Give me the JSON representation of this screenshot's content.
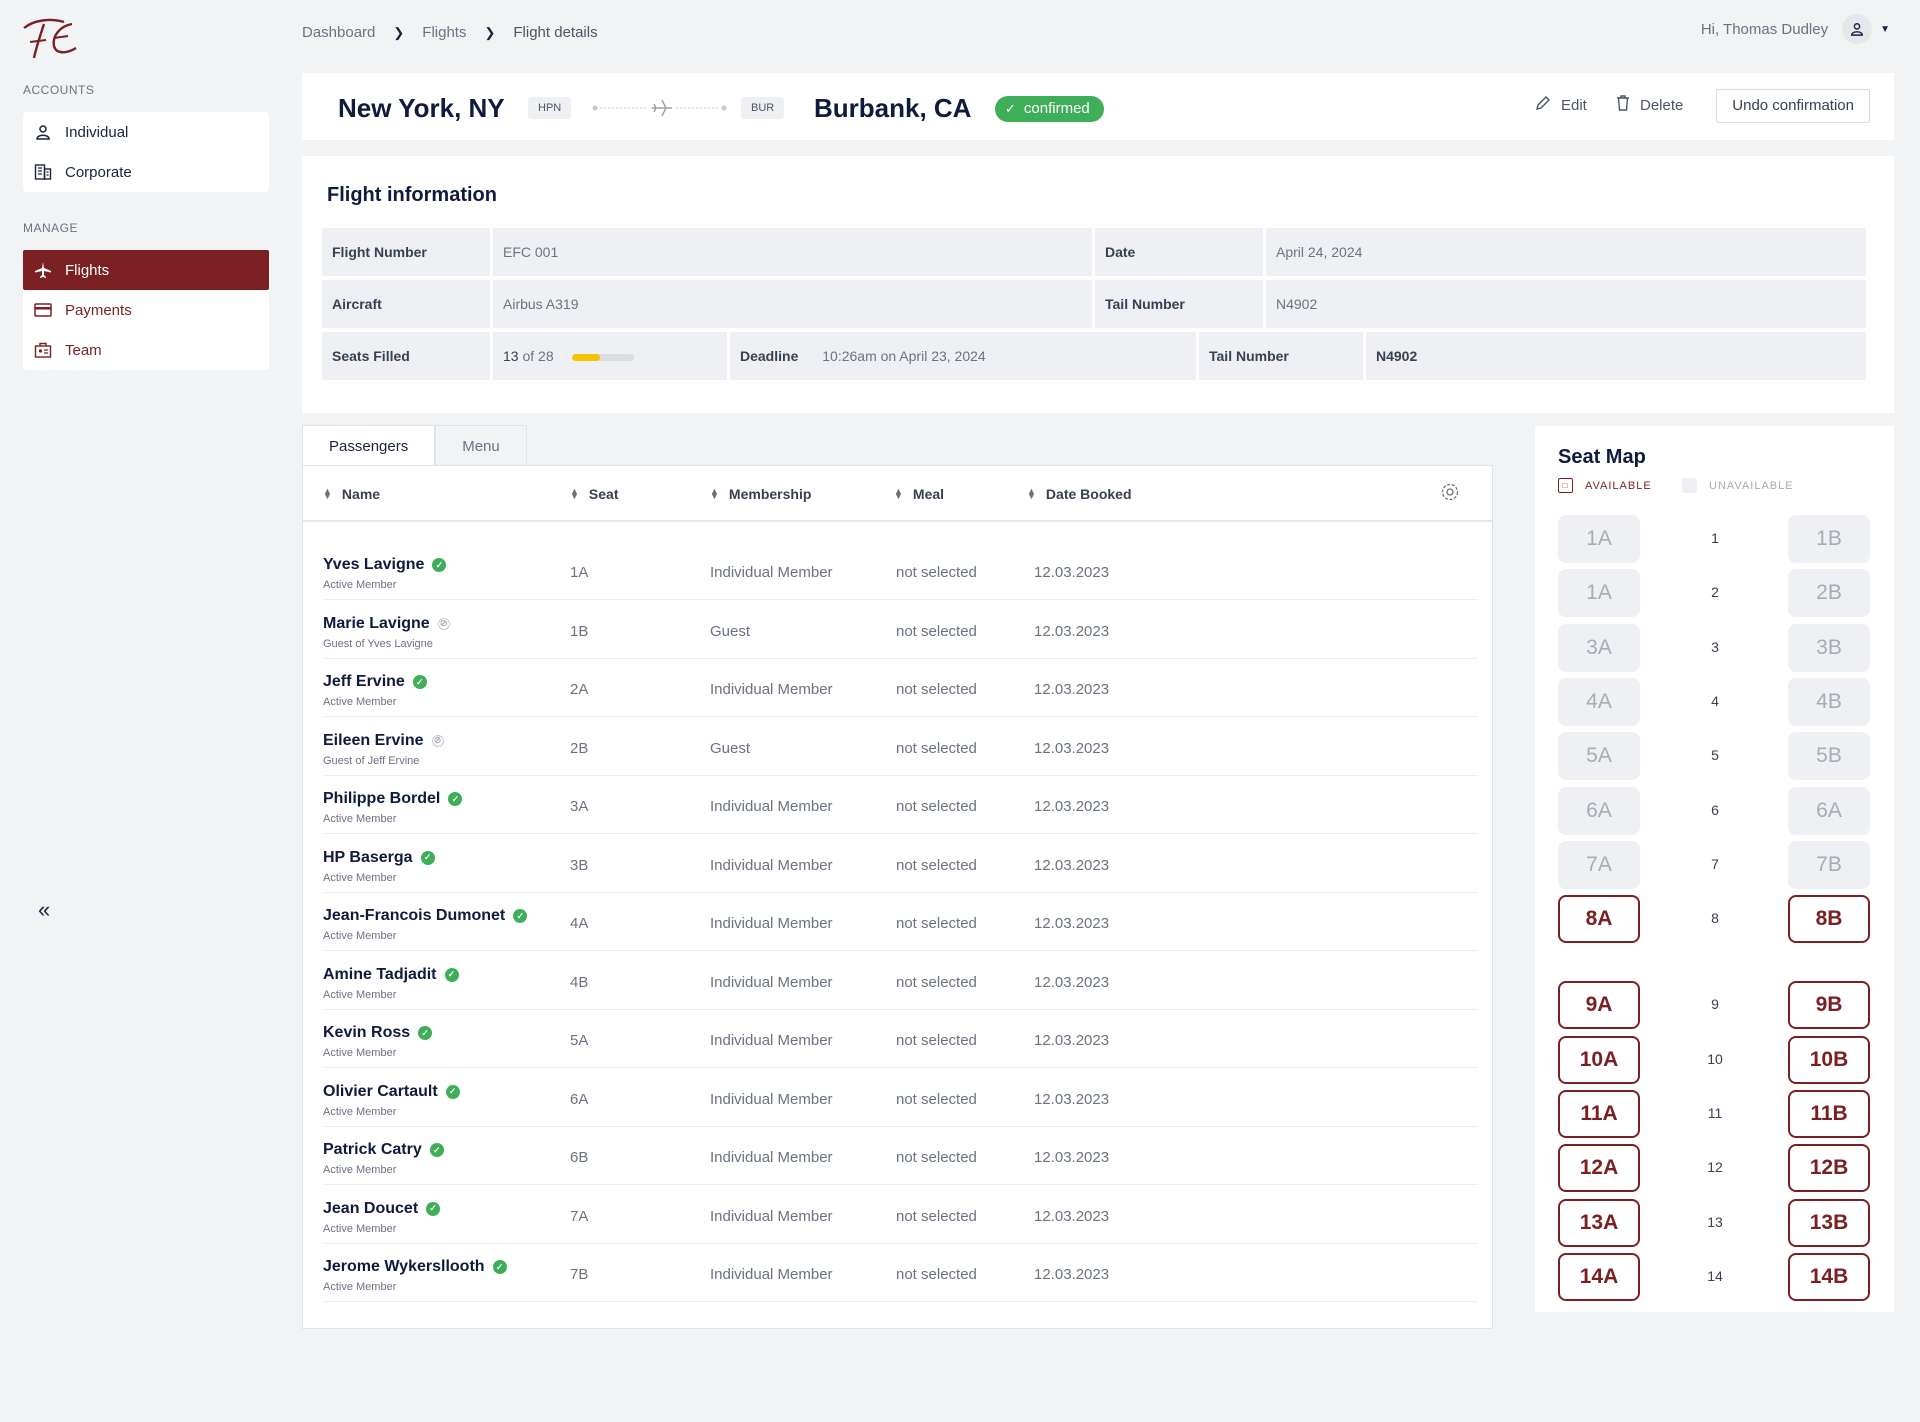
{
  "sidebar": {
    "accounts_label": "ACCOUNTS",
    "accounts": [
      {
        "label": "Individual",
        "icon": "user-icon"
      },
      {
        "label": "Corporate",
        "icon": "building-icon"
      }
    ],
    "manage_label": "MANAGE",
    "manage": [
      {
        "label": "Flights",
        "icon": "plane-icon",
        "active": true
      },
      {
        "label": "Payments",
        "icon": "credit-card-icon"
      },
      {
        "label": "Team",
        "icon": "team-icon"
      }
    ],
    "collapse_icon": "«"
  },
  "breadcrumb": [
    "Dashboard",
    "Flights",
    "Flight details"
  ],
  "user": {
    "greeting": "Hi, Thomas Dudley"
  },
  "route": {
    "origin": "New York, NY",
    "origin_code": "HPN",
    "destination": "Burbank, CA",
    "destination_code": "BUR",
    "status": "confirmed",
    "edit_label": "Edit",
    "delete_label": "Delete",
    "undo_label": "Undo confirmation"
  },
  "flight_info": {
    "title": "Flight information",
    "flight_number_label": "Flight Number",
    "flight_number": "EFC 001",
    "date_label": "Date",
    "date": "April 24, 2024",
    "aircraft_label": "Aircraft",
    "aircraft": "Airbus A319",
    "tail_label": "Tail Number",
    "tail": "N4902",
    "seats_label": "Seats Filled",
    "seats_filled": "13",
    "seats_of": "of 28",
    "seats_fraction": 0.46,
    "deadline_label": "Deadline",
    "deadline": "10:26am on April 23, 2024",
    "tail_label_2": "Tail Number",
    "tail_2": "N4902"
  },
  "tabs": [
    "Passengers",
    "Menu"
  ],
  "table": {
    "columns": [
      "Name",
      "Seat",
      "Membership",
      "Meal",
      "Date Booked"
    ],
    "rows": [
      {
        "name": "Yves Lavigne",
        "type": "member",
        "sub": "Active Member",
        "seat": "1A",
        "membership": "Individual Member",
        "meal": "not selected",
        "date": "12.03.2023"
      },
      {
        "name": "Marie Lavigne",
        "type": "guest",
        "sub": "Guest of Yves Lavigne",
        "seat": "1B",
        "membership": "Guest",
        "meal": "not selected",
        "date": "12.03.2023"
      },
      {
        "name": "Jeff Ervine",
        "type": "member",
        "sub": "Active Member",
        "seat": "2A",
        "membership": "Individual Member",
        "meal": "not selected",
        "date": "12.03.2023"
      },
      {
        "name": "Eileen Ervine",
        "type": "guest",
        "sub": "Guest of Jeff Ervine",
        "seat": "2B",
        "membership": "Guest",
        "meal": "not selected",
        "date": "12.03.2023"
      },
      {
        "name": "Philippe Bordel",
        "type": "member",
        "sub": "Active Member",
        "seat": "3A",
        "membership": "Individual Member",
        "meal": "not selected",
        "date": "12.03.2023"
      },
      {
        "name": "HP Baserga",
        "type": "member",
        "sub": "Active Member",
        "seat": "3B",
        "membership": "Individual Member",
        "meal": "not selected",
        "date": "12.03.2023"
      },
      {
        "name": "Jean-Francois Dumonet",
        "type": "member",
        "sub": "Active Member",
        "seat": "4A",
        "membership": "Individual Member",
        "meal": "not selected",
        "date": "12.03.2023"
      },
      {
        "name": "Amine Tadjadit",
        "type": "member",
        "sub": "Active Member",
        "seat": "4B",
        "membership": "Individual Member",
        "meal": "not selected",
        "date": "12.03.2023"
      },
      {
        "name": "Kevin Ross",
        "type": "member",
        "sub": "Active Member",
        "seat": "5A",
        "membership": "Individual Member",
        "meal": "not selected",
        "date": "12.03.2023"
      },
      {
        "name": "Olivier Cartault",
        "type": "member",
        "sub": "Active Member",
        "seat": "6A",
        "membership": "Individual Member",
        "meal": "not selected",
        "date": "12.03.2023"
      },
      {
        "name": "Patrick Catry",
        "type": "member",
        "sub": "Active Member",
        "seat": "6B",
        "membership": "Individual Member",
        "meal": "not selected",
        "date": "12.03.2023"
      },
      {
        "name": "Jean Doucet",
        "type": "member",
        "sub": "Active Member",
        "seat": "7A",
        "membership": "Individual Member",
        "meal": "not selected",
        "date": "12.03.2023"
      },
      {
        "name": "Jerome Wykersllooth",
        "type": "member",
        "sub": "Active Member",
        "seat": "7B",
        "membership": "Individual Member",
        "meal": "not selected",
        "date": "12.03.2023"
      }
    ]
  },
  "seat_map": {
    "title": "Seat Map",
    "legend_available": "AVAILABLE",
    "legend_unavailable": "UNAVAILABLE",
    "rows": [
      {
        "num": "1",
        "a": "1A",
        "b": "1B",
        "available": false
      },
      {
        "num": "2",
        "a": "1A",
        "b": "2B",
        "available": false
      },
      {
        "num": "3",
        "a": "3A",
        "b": "3B",
        "available": false
      },
      {
        "num": "4",
        "a": "4A",
        "b": "4B",
        "available": false
      },
      {
        "num": "5",
        "a": "5A",
        "b": "5B",
        "available": false
      },
      {
        "num": "6",
        "a": "6A",
        "b": "6A",
        "available": false
      },
      {
        "num": "7",
        "a": "7A",
        "b": "7B",
        "available": false
      },
      {
        "num": "8",
        "a": "8A",
        "b": "8B",
        "available": true
      },
      {
        "num": "9",
        "a": "9A",
        "b": "9B",
        "available": true
      },
      {
        "num": "10",
        "a": "10A",
        "b": "10B",
        "available": true
      },
      {
        "num": "11",
        "a": "11A",
        "b": "11B",
        "available": true
      },
      {
        "num": "12",
        "a": "12A",
        "b": "12B",
        "available": true
      },
      {
        "num": "13",
        "a": "13A",
        "b": "13B",
        "available": true
      },
      {
        "num": "14",
        "a": "14A",
        "b": "14B",
        "available": true
      }
    ]
  },
  "colors": {
    "brand": "#7a1f22",
    "success": "#3fae59",
    "progress": "#f5c400"
  }
}
